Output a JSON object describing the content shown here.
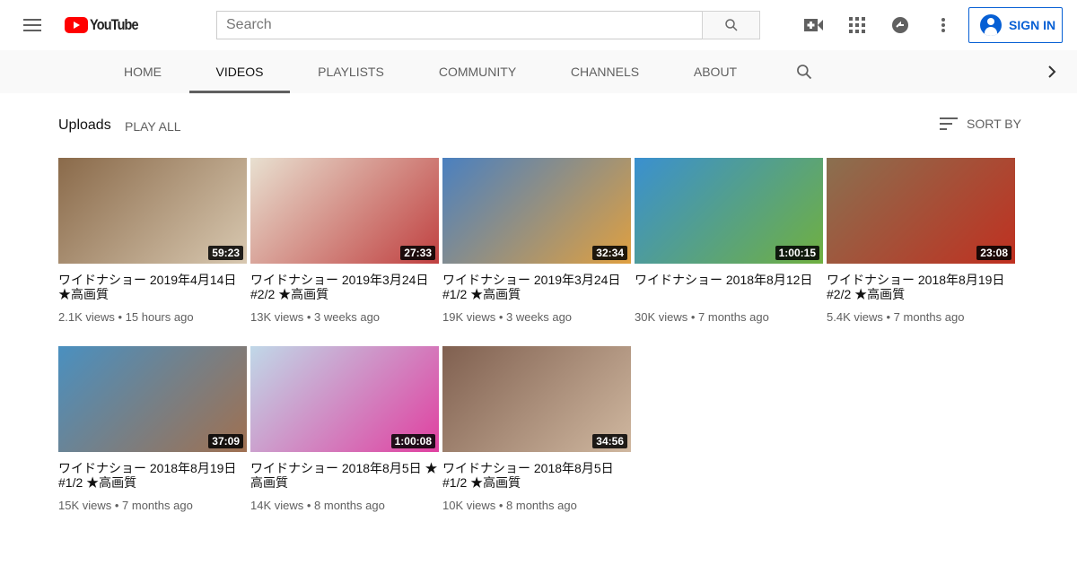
{
  "header": {
    "logo_text": "YouTube",
    "search_placeholder": "Search",
    "sign_in": "SIGN IN"
  },
  "tabs": [
    {
      "label": "HOME"
    },
    {
      "label": "VIDEOS",
      "active": true
    },
    {
      "label": "PLAYLISTS"
    },
    {
      "label": "COMMUNITY"
    },
    {
      "label": "CHANNELS"
    },
    {
      "label": "ABOUT"
    }
  ],
  "section": {
    "title": "Uploads",
    "play_all": "PLAY ALL",
    "sort_by": "SORT BY"
  },
  "videos": [
    {
      "title": "ワイドナショー 2019年4月14日 ★高画質",
      "duration": "59:23",
      "views": "2.1K views",
      "age": "15 hours ago",
      "colors": [
        "#8a6a4a",
        "#d8c8b0"
      ]
    },
    {
      "title": "ワイドナショー 2019年3月24日 #2/2 ★高画質",
      "duration": "27:33",
      "views": "13K views",
      "age": "3 weeks ago",
      "colors": [
        "#e8e0d0",
        "#c04040"
      ]
    },
    {
      "title": "ワイドナショー 2019年3月24日 #1/2 ★高画質",
      "duration": "32:34",
      "views": "19K views",
      "age": "3 weeks ago",
      "colors": [
        "#4a80c0",
        "#e0a040"
      ]
    },
    {
      "title": "ワイドナショー 2018年8月12日",
      "duration": "1:00:15",
      "views": "30K views",
      "age": "7 months ago",
      "colors": [
        "#3a90d0",
        "#70b040"
      ]
    },
    {
      "title": "ワイドナショー 2018年8月19日 #2/2 ★高画質",
      "duration": "23:08",
      "views": "5.4K views",
      "age": "7 months ago",
      "colors": [
        "#8a7050",
        "#c03020"
      ]
    },
    {
      "title": "ワイドナショー 2018年8月19日 #1/2 ★高画質",
      "duration": "37:09",
      "views": "15K views",
      "age": "7 months ago",
      "colors": [
        "#4a90c0",
        "#a07050"
      ]
    },
    {
      "title": "ワイドナショー 2018年8月5日 ★高画質",
      "duration": "1:00:08",
      "views": "14K views",
      "age": "8 months ago",
      "colors": [
        "#c0d8e8",
        "#e040a0"
      ]
    },
    {
      "title": "ワイドナショー 2018年8月5日 #1/2 ★高画質",
      "duration": "34:56",
      "views": "10K views",
      "age": "8 months ago",
      "colors": [
        "#806050",
        "#d0b8a0"
      ]
    }
  ]
}
